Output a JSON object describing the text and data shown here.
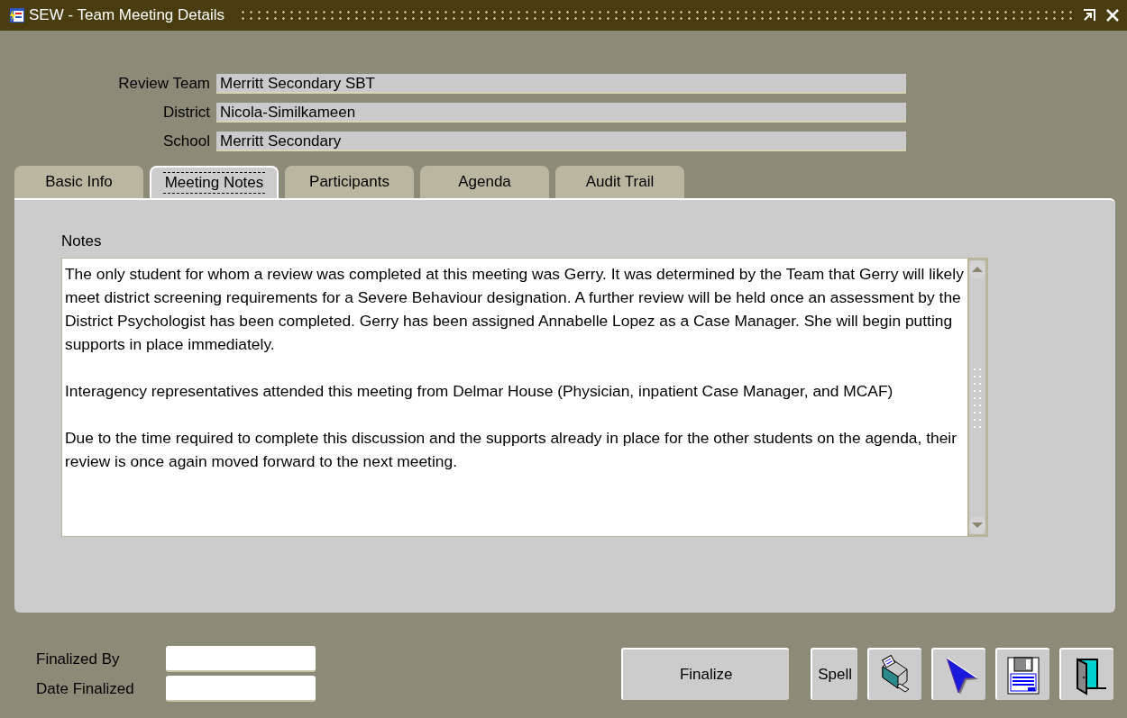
{
  "window": {
    "title": "SEW - Team Meeting Details"
  },
  "header_fields": [
    {
      "label": "Review Team",
      "value": "Merritt Secondary SBT"
    },
    {
      "label": "District",
      "value": "Nicola-Similkameen"
    },
    {
      "label": "School",
      "value": "Merritt Secondary"
    }
  ],
  "tabs": [
    {
      "label": "Basic Info",
      "selected": false
    },
    {
      "label": "Meeting Notes",
      "selected": true
    },
    {
      "label": "Participants",
      "selected": false
    },
    {
      "label": "Agenda",
      "selected": false
    },
    {
      "label": "Audit Trail",
      "selected": false
    }
  ],
  "notes": {
    "label": "Notes",
    "paragraphs": [
      "The only student for whom a review was completed at this meeting was Gerry. It was determined by the Team that Gerry will likely meet district screening requirements for a Severe Behaviour designation. A further review will be held once an assessment by the District Psychologist has been completed. Gerry has been assigned Annabelle Lopez as a Case Manager. She will begin putting supports in place immediately.",
      "Interagency representatives attended this meeting from Delmar House (Physician, inpatient Case Manager, and MCAF)",
      "Due to the time required to complete this discussion and the supports already in place for the other students on the agenda, their review is once again moved forward to the next meeting."
    ]
  },
  "footer_fields": [
    {
      "label": "Finalized By"
    },
    {
      "label": "Date Finalized"
    }
  ],
  "buttons": [
    {
      "label": "Finalize"
    },
    {
      "label": "Spell"
    }
  ]
}
